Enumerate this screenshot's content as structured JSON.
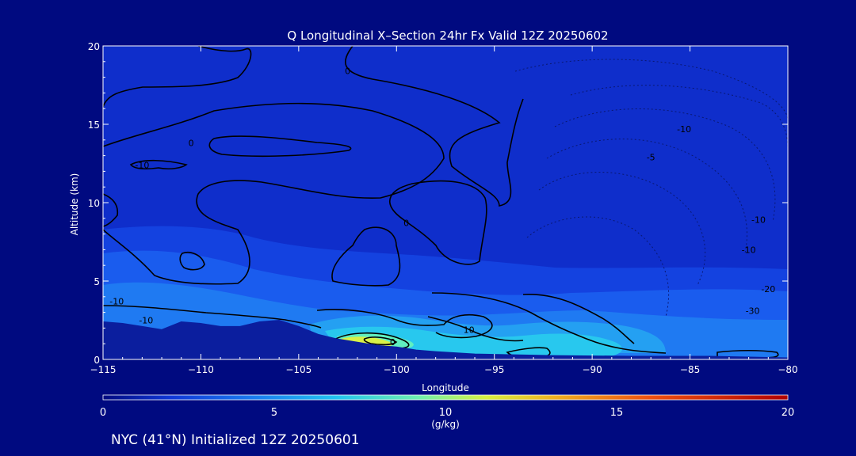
{
  "chart_data": {
    "type": "heatmap",
    "title": "Q Longitudinal X–Section 24hr  Fx Valid 12Z 20250602",
    "xlabel": "Longitude",
    "ylabel": "Altitude (km)",
    "xlim": [
      -115,
      -80
    ],
    "ylim": [
      0,
      20
    ],
    "x_ticks": [
      "−115",
      "−110",
      "−105",
      "−100",
      "−95",
      "−90",
      "−85",
      "−80"
    ],
    "y_ticks": [
      "0",
      "5",
      "10",
      "15",
      "20"
    ],
    "x_tick_values": [
      -115,
      -110,
      -105,
      -100,
      -95,
      -90,
      -85,
      -80
    ],
    "y_tick_values": [
      0,
      5,
      10,
      15,
      20
    ],
    "colorbar": {
      "label": "(g/kg)",
      "min": 0,
      "max": 20,
      "ticks": [
        "0",
        "5",
        "10",
        "15",
        "20"
      ],
      "tick_values": [
        0,
        5,
        10,
        15,
        20
      ]
    },
    "contour_labels": [
      {
        "text": "0",
        "lon": -102.5,
        "alt": 18.2
      },
      {
        "text": "0",
        "lon": -110.5,
        "alt": 13.6
      },
      {
        "text": "-10",
        "lon": -113.0,
        "alt": 12.2
      },
      {
        "text": "0",
        "lon": -99.5,
        "alt": 8.5
      },
      {
        "text": "-10",
        "lon": -85.3,
        "alt": 14.5
      },
      {
        "text": "-5",
        "lon": -87.0,
        "alt": 12.7
      },
      {
        "text": "-10",
        "lon": -81.5,
        "alt": 8.7
      },
      {
        "text": "-10",
        "lon": -82.0,
        "alt": 6.8
      },
      {
        "text": "-20",
        "lon": -81.0,
        "alt": 4.3
      },
      {
        "text": "-30",
        "lon": -81.8,
        "alt": 2.9
      },
      {
        "text": "-10",
        "lon": -114.3,
        "alt": 3.5
      },
      {
        "text": "-10",
        "lon": -112.8,
        "alt": 2.3
      },
      {
        "text": "10",
        "lon": -96.3,
        "alt": 1.7
      },
      {
        "text": "0",
        "lon": -100.2,
        "alt": 0.9
      }
    ],
    "terrain_alt_km": [
      [
        -115,
        2.4
      ],
      [
        -114,
        2.3
      ],
      [
        -113,
        2.1
      ],
      [
        -112,
        1.9
      ],
      [
        -111,
        2.4
      ],
      [
        -110,
        2.3
      ],
      [
        -109,
        2.1
      ],
      [
        -108,
        2.1
      ],
      [
        -107,
        2.4
      ],
      [
        -106,
        2.5
      ],
      [
        -105,
        2.1
      ],
      [
        -104,
        1.6
      ],
      [
        -103,
        1.3
      ],
      [
        -102,
        1.1
      ],
      [
        -101,
        0.9
      ],
      [
        -100,
        0.8
      ],
      [
        -99,
        0.6
      ],
      [
        -98,
        0.5
      ],
      [
        -96,
        0.35
      ],
      [
        -94,
        0.3
      ],
      [
        -92,
        0.25
      ],
      [
        -88,
        0.2
      ],
      [
        -84,
        0.2
      ],
      [
        -80,
        0.1
      ]
    ]
  },
  "footer": {
    "caption": "NYC (41°N) Initialized 12Z 20250601"
  },
  "colors": {
    "background": "#000a80",
    "plot_background": "#0f2ecb",
    "terrain": "#0b1e9e",
    "contour": "#000000"
  }
}
